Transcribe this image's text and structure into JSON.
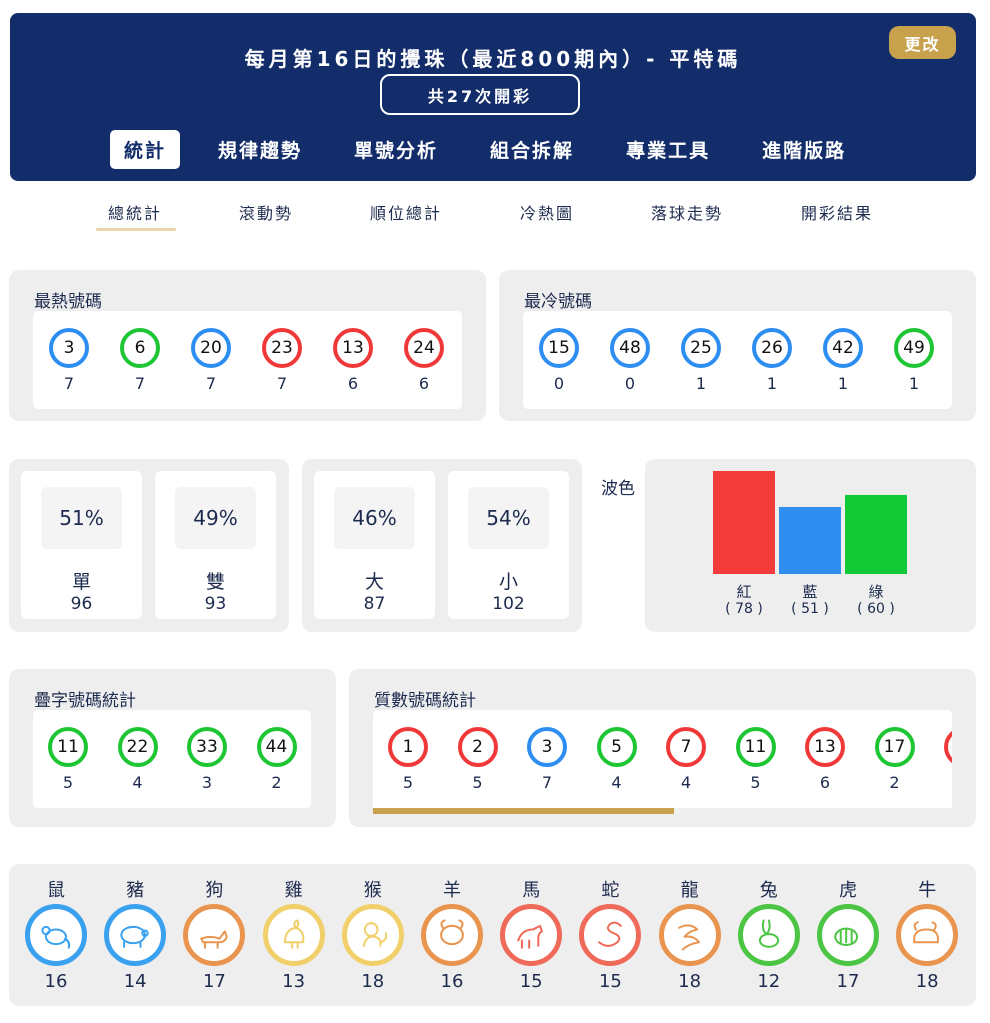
{
  "header": {
    "title": "每月第16日的攪珠（最近800期內）- 平特碼",
    "change_label": "更改",
    "draw_count": "共27次開彩",
    "tabs": [
      "統計",
      "規律趨勢",
      "單號分析",
      "組合拆解",
      "專業工具",
      "進階版路"
    ],
    "active_tab": "統計"
  },
  "sub_tabs": [
    "總統計",
    "滾動勢",
    "順位總計",
    "冷熱圖",
    "落球走勢",
    "開彩結果"
  ],
  "active_sub_tab": "總統計",
  "hottest": {
    "title": "最熱號碼",
    "balls": [
      {
        "num": "3",
        "color": "blue",
        "count": "7"
      },
      {
        "num": "6",
        "color": "green",
        "count": "7"
      },
      {
        "num": "20",
        "color": "blue",
        "count": "7"
      },
      {
        "num": "23",
        "color": "red",
        "count": "7"
      },
      {
        "num": "13",
        "color": "red",
        "count": "6"
      },
      {
        "num": "24",
        "color": "red",
        "count": "6"
      }
    ]
  },
  "coldest": {
    "title": "最冷號碼",
    "balls": [
      {
        "num": "15",
        "color": "blue",
        "count": "0"
      },
      {
        "num": "48",
        "color": "blue",
        "count": "0"
      },
      {
        "num": "25",
        "color": "blue",
        "count": "1"
      },
      {
        "num": "26",
        "color": "blue",
        "count": "1"
      },
      {
        "num": "42",
        "color": "blue",
        "count": "1"
      },
      {
        "num": "49",
        "color": "green",
        "count": "1"
      }
    ]
  },
  "odd_even": [
    {
      "pct": "51%",
      "label": "單",
      "count": "96"
    },
    {
      "pct": "49%",
      "label": "雙",
      "count": "93"
    }
  ],
  "big_small": [
    {
      "pct": "46%",
      "label": "大",
      "count": "87"
    },
    {
      "pct": "54%",
      "label": "小",
      "count": "102"
    }
  ],
  "wave_color": {
    "title": "波色",
    "bars": [
      {
        "label": "紅",
        "count": "( 78 )",
        "value": 78,
        "color": "#f33b3b"
      },
      {
        "label": "藍",
        "count": "( 51 )",
        "value": 51,
        "color": "#2f8ef0"
      },
      {
        "label": "綠",
        "count": "( 60 )",
        "value": 60,
        "color": "#12c936"
      }
    ]
  },
  "doubles": {
    "title": "疊字號碼統計",
    "balls": [
      {
        "num": "11",
        "color": "green",
        "count": "5"
      },
      {
        "num": "22",
        "color": "green",
        "count": "4"
      },
      {
        "num": "33",
        "color": "green",
        "count": "3"
      },
      {
        "num": "44",
        "color": "green",
        "count": "2"
      }
    ]
  },
  "primes": {
    "title": "質數號碼統計",
    "balls": [
      {
        "num": "1",
        "color": "red",
        "count": "5"
      },
      {
        "num": "2",
        "color": "red",
        "count": "5"
      },
      {
        "num": "3",
        "color": "blue",
        "count": "7"
      },
      {
        "num": "5",
        "color": "green",
        "count": "4"
      },
      {
        "num": "7",
        "color": "red",
        "count": "4"
      },
      {
        "num": "11",
        "color": "green",
        "count": "5"
      },
      {
        "num": "13",
        "color": "red",
        "count": "6"
      },
      {
        "num": "17",
        "color": "green",
        "count": "2"
      },
      {
        "num": "",
        "color": "red",
        "count": ""
      }
    ],
    "scroll_fraction": 0.52
  },
  "zodiac": [
    {
      "name": "鼠",
      "icon": "rat-icon",
      "color": "#3aa1ef",
      "count": "16"
    },
    {
      "name": "豬",
      "icon": "pig-icon",
      "color": "#3aa1ef",
      "count": "14"
    },
    {
      "name": "狗",
      "icon": "dog-icon",
      "color": "#e9954f",
      "count": "17"
    },
    {
      "name": "雞",
      "icon": "rooster-icon",
      "color": "#f1cf6a",
      "count": "13"
    },
    {
      "name": "猴",
      "icon": "monkey-icon",
      "color": "#f1cf6a",
      "count": "18"
    },
    {
      "name": "羊",
      "icon": "goat-icon",
      "color": "#e9954f",
      "count": "16"
    },
    {
      "name": "馬",
      "icon": "horse-icon",
      "color": "#f06a5a",
      "count": "15"
    },
    {
      "name": "蛇",
      "icon": "snake-icon",
      "color": "#f06a5a",
      "count": "15"
    },
    {
      "name": "龍",
      "icon": "dragon-icon",
      "color": "#e9954f",
      "count": "18"
    },
    {
      "name": "兔",
      "icon": "rabbit-icon",
      "color": "#4cc544",
      "count": "12"
    },
    {
      "name": "虎",
      "icon": "tiger-icon",
      "color": "#4cc544",
      "count": "17"
    },
    {
      "name": "牛",
      "icon": "ox-icon",
      "color": "#e9954f",
      "count": "18"
    }
  ]
}
